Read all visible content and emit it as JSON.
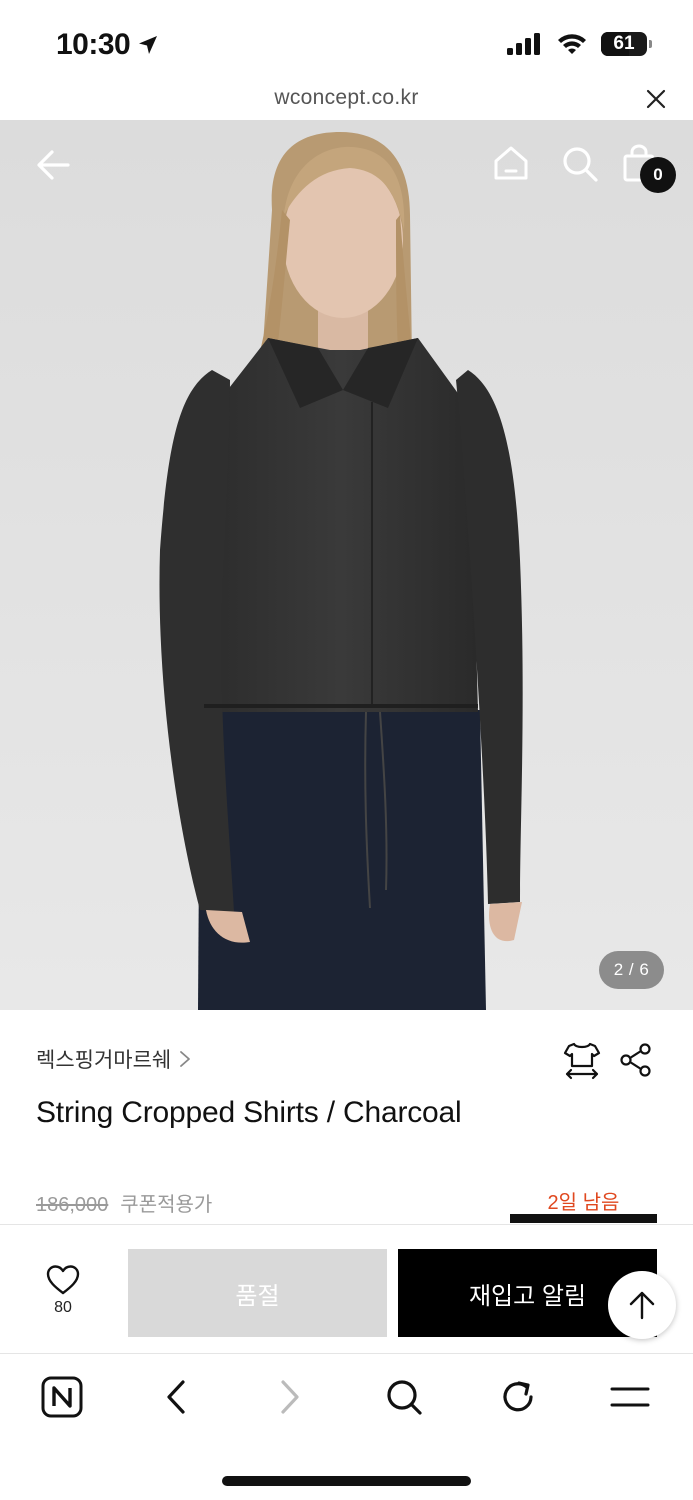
{
  "status_bar": {
    "time": "10:30",
    "battery": "61",
    "battery_level": 0.61
  },
  "url_bar": {
    "domain": "wconcept.co.kr"
  },
  "gallery": {
    "current": 2,
    "total": 6,
    "indicator": "2 / 6",
    "cart_count": "0"
  },
  "product": {
    "brand": "렉스핑거마르쉐",
    "title": "String Cropped Shirts / Charcoal",
    "original_price": "186,000",
    "coupon_label": "쿠폰적용가",
    "days_left": "2일 남음"
  },
  "actions": {
    "like_count": "80",
    "soldout_label": "품절",
    "restock_label": "재입고 알림"
  },
  "colors": {
    "accent": "#e0481f",
    "primary_button": "#000000",
    "disabled_button": "#d9d9d9"
  },
  "icons": {
    "status": [
      "location-arrow-icon",
      "signal-icon",
      "wifi-icon",
      "battery-icon"
    ],
    "header": [
      "back-arrow-icon",
      "home-icon",
      "search-icon",
      "shopping-bag-icon"
    ],
    "product": [
      "chevron-right-icon",
      "size-guide-icon",
      "share-icon"
    ],
    "action": [
      "heart-icon",
      "arrow-up-icon"
    ],
    "toolbar": [
      "naver-icon",
      "chevron-left-icon",
      "chevron-right-icon",
      "search-icon",
      "reload-icon",
      "menu-icon"
    ]
  }
}
